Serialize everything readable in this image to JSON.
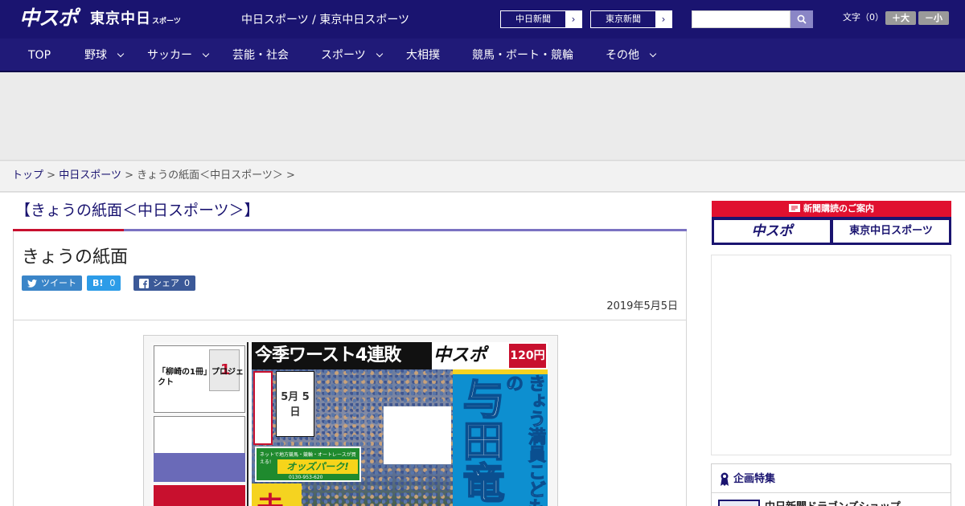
{
  "header": {
    "logo_main": "中スポ",
    "logo_sub": "東京中日",
    "logo_sub_small": "スポーツ",
    "site_title": "中日スポーツ / 東京中日スポーツ",
    "paper_links": [
      "中日新聞",
      "東京新聞"
    ],
    "search_placeholder": "",
    "font_size_label": "文字（0）",
    "font_bigger": "＋大",
    "font_smaller": "－小"
  },
  "nav": {
    "items": [
      {
        "label": "TOP",
        "dropdown": false
      },
      {
        "label": "野球",
        "dropdown": true
      },
      {
        "label": "サッカー",
        "dropdown": true
      },
      {
        "label": "芸能・社会",
        "dropdown": false
      },
      {
        "label": "スポーツ",
        "dropdown": true
      },
      {
        "label": "大相撲",
        "dropdown": false
      },
      {
        "label": "競馬・ボート・競輪",
        "dropdown": false
      },
      {
        "label": "その他",
        "dropdown": true
      }
    ]
  },
  "breadcrumb": {
    "items": [
      "トップ",
      "中日スポーツ",
      "きょうの紙面＜中日スポーツ＞"
    ],
    "separator": ">"
  },
  "section": {
    "heading": "【きょうの紙面＜中日スポーツ＞】"
  },
  "article": {
    "title": "きょうの紙面",
    "share_tweet": "ツイート",
    "share_hatena_label": "B!",
    "share_hatena_count": "0",
    "share_fb_label": "シェア",
    "share_fb_count": "0",
    "date": "2019年5月5日"
  },
  "paper_image": {
    "headline": "今季ワースト4連敗",
    "brand": "中スポ",
    "price": "120円",
    "date_box_day": "5月 5日",
    "odds_banner": "オッズパーク!",
    "odds_small": "ネットで地方競馬・競輪・オートレースが買える!",
    "odds_phone": "0130-953-620",
    "vertical_sub": "きょう満員こどもの",
    "vertical_big": "与田竜",
    "ad_title": "「柳崎の1冊」プロジェクト",
    "ad_shirt_number": "1",
    "big_red_char": "未"
  },
  "sidebar": {
    "subscribe_heading": "新聞購読のご案内",
    "subscribe_buttons": [
      "中スポ",
      "東京中日スポーツ"
    ],
    "feature_heading": "企画特集",
    "feature_item": "中日新聞ドラゴンズショップ"
  },
  "colors": {
    "header_bg": "#1a1470",
    "accent_red": "#c8102e",
    "accent_purple": "#7b72c2"
  }
}
